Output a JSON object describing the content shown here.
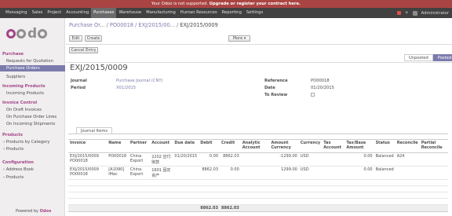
{
  "notice": {
    "text": "Your Odoo is not supported.",
    "action": "Upgrade or register your contract here."
  },
  "topbar": {
    "menu": [
      "Messaging",
      "Sales",
      "Project",
      "Accounting",
      "Purchases",
      "Warehouse",
      "Manufacturing",
      "Human Resources",
      "Reporting",
      "Settings"
    ],
    "active": "Purchases",
    "user": "Administrator"
  },
  "sidebar": {
    "sections": [
      {
        "title": "Purchase",
        "items": [
          "Requests for Quotation",
          "Purchase Orders",
          "Suppliers"
        ]
      },
      {
        "title": "Incoming Products",
        "items": [
          "Incoming Products"
        ]
      },
      {
        "title": "Invoice Control",
        "items": [
          "On Draft Invoices",
          "On Purchase Order Lines",
          "On Incoming Shipments"
        ]
      },
      {
        "title": "Products",
        "items": [
          "Products by Category",
          "Products"
        ]
      },
      {
        "title": "Configuration",
        "items": [
          "Address Book",
          "Products"
        ]
      }
    ],
    "active_item": "Purchase Orders",
    "powered_prefix": "Powered by",
    "powered_brand": "Odoo"
  },
  "breadcrumb": {
    "items": [
      "Purchase Or...",
      "PO00018 / EXJ/2015/00..."
    ],
    "current": "EXJ/2015/0009"
  },
  "buttons": {
    "edit": "Edit",
    "create": "Create",
    "more": "More ▾",
    "cancel_entry": "Cancel Entry"
  },
  "status": {
    "unposted": "Unposted",
    "posted": "Posted"
  },
  "form": {
    "title": "EXJ/2015/0009",
    "journal_label": "Journal",
    "journal_value": "Purchase Journal (CNY)",
    "period_label": "Period",
    "period_value": "X01/2015",
    "reference_label": "Reference",
    "reference_value": "PO00018",
    "date_label": "Date",
    "date_value": "01/20/2015",
    "to_review_label": "To Review"
  },
  "tab": {
    "label": "Journal Items"
  },
  "table": {
    "headers": [
      "Invoice",
      "Name",
      "Partner",
      "Account",
      "Due date",
      "Debit",
      "Credit",
      "Analytic Account",
      "Amount Currency",
      "Currency",
      "Tax Account",
      "Tax/Base Amount",
      "Status",
      "Reconcile",
      "Partial Reconcile"
    ],
    "rows": [
      [
        "EXJ/2015/0009 PO00018",
        "PO00018",
        "China Export",
        "2202 应付账款",
        "01/20/2015",
        "0.00",
        "8862.03",
        "",
        "-1299.00",
        "USD",
        "",
        "0.00",
        "Balanced",
        "A24",
        ""
      ],
      [
        "EXJ/2015/0009 PO00018",
        "[A1090] iMac",
        "China Export",
        "1601 固定资产",
        "",
        "8862.03",
        "0.00",
        "",
        "1299.00",
        "USD",
        "",
        "0.00",
        "Balanced",
        "",
        ""
      ]
    ],
    "totals": {
      "debit": "8862.03",
      "credit": "8862.03"
    }
  }
}
